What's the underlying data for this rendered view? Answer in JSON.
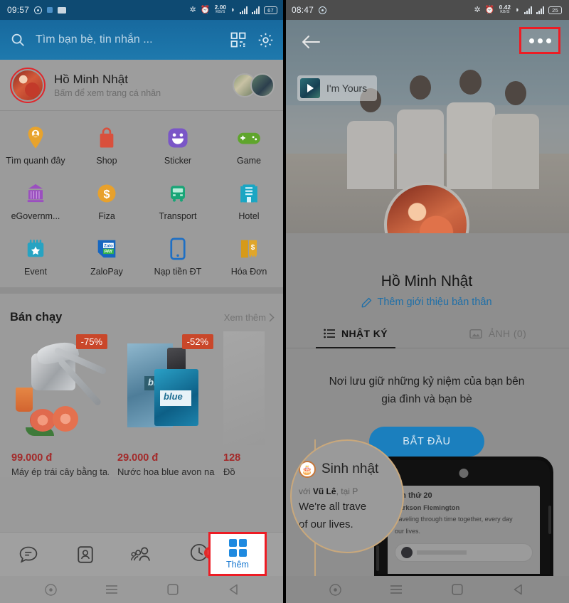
{
  "left": {
    "statusbar": {
      "time": "09:57",
      "net_speed_value": "2.00",
      "net_speed_unit": "KB/S",
      "battery": "67",
      "icons": [
        "bluetooth-icon",
        "alarm-icon",
        "network-speed-icon",
        "wifi-icon",
        "signal-icon",
        "signal-icon",
        "battery-icon"
      ]
    },
    "search": {
      "placeholder": "Tìm bạn bè, tin nhắn ...",
      "search_icon": "search-icon",
      "qr_icon": "qr-scan-icon",
      "settings_icon": "gear-icon"
    },
    "profile": {
      "name": "Hồ Minh Nhật",
      "subtitle": "Bấm để xem trang cá nhân",
      "avatar": "avatar",
      "story_1": "story-thumbnail",
      "story_2": "story-thumbnail"
    },
    "grid": [
      {
        "label": "Tìm quanh đây",
        "icon": "location-pin-person-icon",
        "color": "#e8a32c"
      },
      {
        "label": "Shop",
        "icon": "shopping-bag-icon",
        "color": "#d9503c"
      },
      {
        "label": "Sticker",
        "icon": "sticker-smiley-icon",
        "color": "#7a56c7"
      },
      {
        "label": "Game",
        "icon": "gamepad-icon",
        "color": "#5fa52c"
      },
      {
        "label": "eGovernm...",
        "icon": "government-building-icon",
        "color": "#9b4fc0"
      },
      {
        "label": "Fiza",
        "icon": "dollar-coin-icon",
        "color": "#e8a12c"
      },
      {
        "label": "Transport",
        "icon": "bus-icon",
        "color": "#19a577"
      },
      {
        "label": "Hotel",
        "icon": "hotel-building-icon",
        "color": "#18a6c4"
      },
      {
        "label": "Event",
        "icon": "calendar-star-icon",
        "color": "#27a3c2"
      },
      {
        "label": "ZaloPay",
        "icon": "zalopay-icon",
        "color": "#1667c0"
      },
      {
        "label": "Nạp tiền ĐT",
        "icon": "mobile-topup-icon",
        "color": "#1e6fc4"
      },
      {
        "label": "Hóa Đơn",
        "icon": "invoice-icon",
        "color": "#d69a19"
      }
    ],
    "bestsellers": {
      "title": "Bán chạy",
      "see_more": "Xem thêm",
      "chevron": "chevron-right-icon",
      "products": [
        {
          "badge": "-75%",
          "price": "99.000 đ",
          "name": "Máy ép trái cây bằng ta...",
          "image": "manual-juicer-photo"
        },
        {
          "badge": "-52%",
          "price": "29.000 đ",
          "name": "Nước hoa blue avon na...",
          "image": "blue-perfume-photo"
        },
        {
          "badge": "",
          "price": "128",
          "name": "Đồ",
          "image": "third-product-photo"
        }
      ]
    },
    "tabbar": {
      "items": [
        {
          "label": "",
          "icon": "chat-bubble-icon",
          "badge": ""
        },
        {
          "label": "",
          "icon": "contact-card-icon",
          "badge": ""
        },
        {
          "label": "",
          "icon": "group-people-icon",
          "badge": ""
        },
        {
          "label": "",
          "icon": "timeline-clock-icon",
          "badge": "N"
        }
      ],
      "highlighted": {
        "label": "Thêm",
        "icon": "grid-four-squares-icon"
      }
    },
    "navbar": [
      "assistant-dot-icon",
      "menu-lines-icon",
      "home-square-icon",
      "back-triangle-icon"
    ]
  },
  "right": {
    "statusbar": {
      "time": "08:47",
      "net_speed_value": "0.42",
      "net_speed_unit": "KB/S",
      "battery": "25",
      "icons": [
        "bluetooth-icon",
        "alarm-icon",
        "network-speed-icon",
        "wifi-icon",
        "signal-icon",
        "signal-icon",
        "battery-icon"
      ]
    },
    "cover": {
      "back_icon": "arrow-left-icon",
      "more_icon": "more-options-icon",
      "music_title": "I'm Yours",
      "music_play_icon": "play-icon",
      "music_thumb": "music-thumbnail",
      "photo": "beach-group-photo"
    },
    "profile": {
      "name": "Hồ Minh Nhật",
      "bio_action": "Thêm giới thiệu bản thân",
      "bio_icon": "pencil-icon",
      "avatar": "profile-avatar"
    },
    "tabs": [
      {
        "label": "NHẬT KÝ",
        "icon": "list-icon",
        "active": true
      },
      {
        "label": "ẢNH (0)",
        "icon": "photo-icon",
        "active": false
      }
    ],
    "empty_state": {
      "line1": "Nơi lưu giữ những kỷ niệm của bạn bên",
      "line2": "gia đình và bạn bè",
      "button": "BẮT ĐẦU"
    },
    "birthday_card": {
      "magnifier": {
        "icon": "birthday-cake-icon",
        "title": "Sinh nhật",
        "meta_prefix": "với",
        "meta_name": "Vũ Lê",
        "meta_mid": ", tại P",
        "body_line1": "We're all trave",
        "body_line2": "of our lives."
      },
      "phone_card": {
        "line1": "lần thứ 20",
        "line2": "Parkson Flemington",
        "line3": "traveling through time together, every day",
        "line4": "our lives."
      }
    },
    "navbar": [
      "assistant-dot-icon",
      "menu-lines-icon",
      "home-square-icon",
      "back-triangle-icon"
    ]
  }
}
